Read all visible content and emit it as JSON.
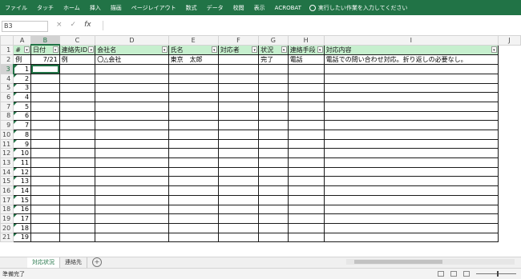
{
  "ribbon": {
    "tabs": [
      "ファイル",
      "タッチ",
      "ホーム",
      "挿入",
      "描画",
      "ページレイアウト",
      "数式",
      "データ",
      "校閲",
      "表示",
      "ACROBAT"
    ],
    "tell_me": "実行したい作業を入力してください"
  },
  "formula_bar": {
    "name_box": "B3",
    "fx": "fx",
    "cancel": "×",
    "confirm": "✓"
  },
  "columns": [
    "A",
    "B",
    "C",
    "D",
    "E",
    "F",
    "G",
    "H",
    "I",
    "J"
  ],
  "selected_column": "B",
  "selected_row": "3",
  "header_row": [
    "#",
    "日付",
    "連絡先ID",
    "会社名",
    "氏名",
    "対応者",
    "状況",
    "連絡手段",
    "対応内容"
  ],
  "example_row": [
    "例",
    "7/21",
    "例",
    "〇△会社",
    "東京　太郎",
    "",
    "完了",
    "電話",
    "電話での問い合わせ対応。折り返しの必要なし。"
  ],
  "row_numbers": [
    "1",
    "2",
    "3",
    "4",
    "5",
    "6",
    "7",
    "8",
    "9",
    "10",
    "11",
    "12",
    "13",
    "14",
    "15",
    "16",
    "17",
    "18",
    "19",
    "20",
    "21"
  ],
  "data_numbers": [
    "1",
    "2",
    "3",
    "4",
    "5",
    "6",
    "7",
    "8",
    "9",
    "10",
    "11",
    "12",
    "13",
    "14",
    "15",
    "16",
    "17",
    "18",
    "19"
  ],
  "sheet_tabs": [
    "対応状況",
    "連絡先"
  ],
  "active_sheet": "対応状況",
  "status": {
    "ready": "準備完了"
  },
  "colors": {
    "ribbon": "#217346",
    "header_fill": "#c6efce",
    "accent": "#217346"
  }
}
